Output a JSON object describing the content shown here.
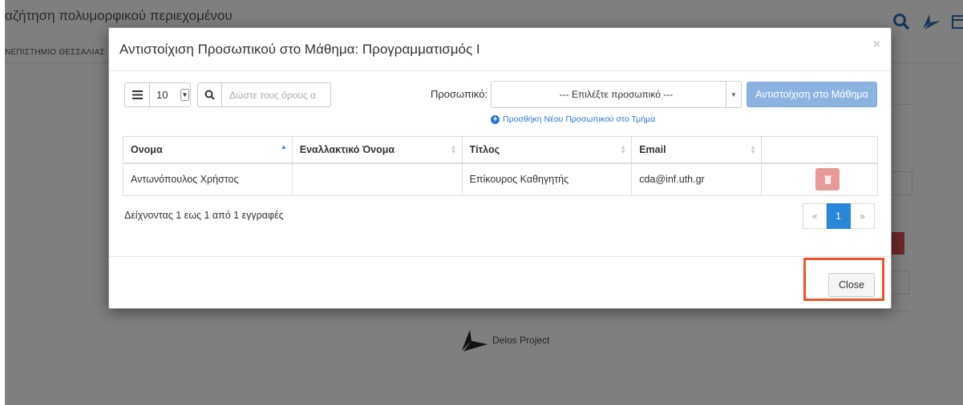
{
  "background": {
    "page_title": "αζήτηση πολυμορφικού περιεχομένου",
    "subtitle": "ΝΕΠΙΣΤΗΜΙΟ ΘΕΣΣΑΛΙΑΣ",
    "footer_text": "Delos Project"
  },
  "modal": {
    "title": "Αντιστοίχιση Προσωπικού στο Μάθημα: Προγραμματισμός Ι",
    "close_x": "×",
    "page_length": "10",
    "search_placeholder": "Δώστε τους όρους α",
    "staff_label": "Προσωπικό:",
    "staff_select_value": "--- Επιλέξτε προσωπικό ---",
    "assign_button": "Αντιστοίχιση στο Μάθημα",
    "add_staff_link": "Προσθήκη Νέου Προσωπικού στο Τμήμα",
    "columns": [
      "Ονομα",
      "Εναλλακτικό Όνομα",
      "Τίτλος",
      "Email"
    ],
    "rows": [
      {
        "name": "Αντωνόπουλος Χρήστος",
        "alt_name": "",
        "title": "Επίκουρος Καθηγητής",
        "email": "cda@inf.uth.gr"
      }
    ],
    "info": "Δείχνοντας 1 εως 1 από 1 εγγραφές",
    "pager": {
      "prev": "«",
      "current": "1",
      "next": "»"
    },
    "close_button": "Close"
  },
  "colors": {
    "accent": "#2a86d8",
    "assign_button": "#8cb3e0",
    "delete_button": "#e89a98",
    "highlight": "#f0522d"
  }
}
